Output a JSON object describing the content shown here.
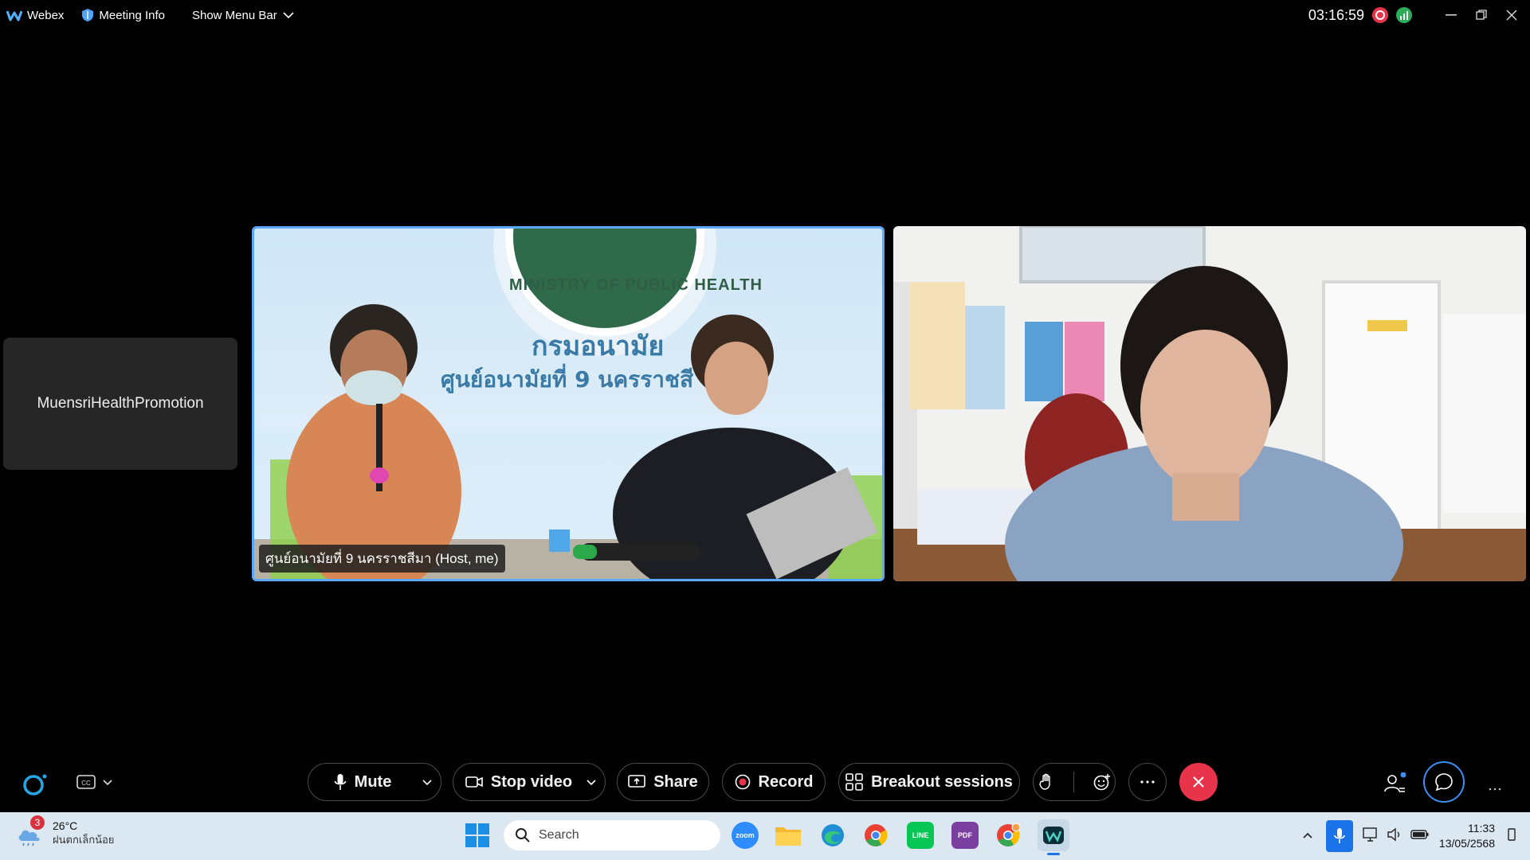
{
  "titlebar": {
    "app_name": "Webex",
    "meeting_info": "Meeting Info",
    "show_menu_bar": "Show Menu Bar",
    "timer": "03:16:59"
  },
  "participants": {
    "offscreen_name": "MuensriHealthPromotion",
    "video1_label": "ศูนย์อนามัยที่ 9 นครราชสีมา (Host, me)"
  },
  "video1_scene": {
    "banner_line1": "กรมอนามัย",
    "banner_line2": "ศูนย์อนามัยที่ 9 นครราชสี",
    "seal_text": "MINISTRY OF PUBLIC HEALTH"
  },
  "toolbar": {
    "mute": "Mute",
    "stop_video": "Stop video",
    "share": "Share",
    "record": "Record",
    "breakout": "Breakout sessions"
  },
  "taskbar": {
    "weather_badge": "3",
    "temperature": "26°C",
    "weather_desc": "ฝนตกเล็กน้อย",
    "search_placeholder": "Search",
    "time": "11:33",
    "date": "13/05/2568",
    "zoom_label": "zoom",
    "line_label": "LINE",
    "pdf_label": "PDF"
  },
  "colors": {
    "accent_blue": "#5aa7ff",
    "end_red": "#e8344a",
    "taskbar_bg": "#dbe8f2"
  }
}
